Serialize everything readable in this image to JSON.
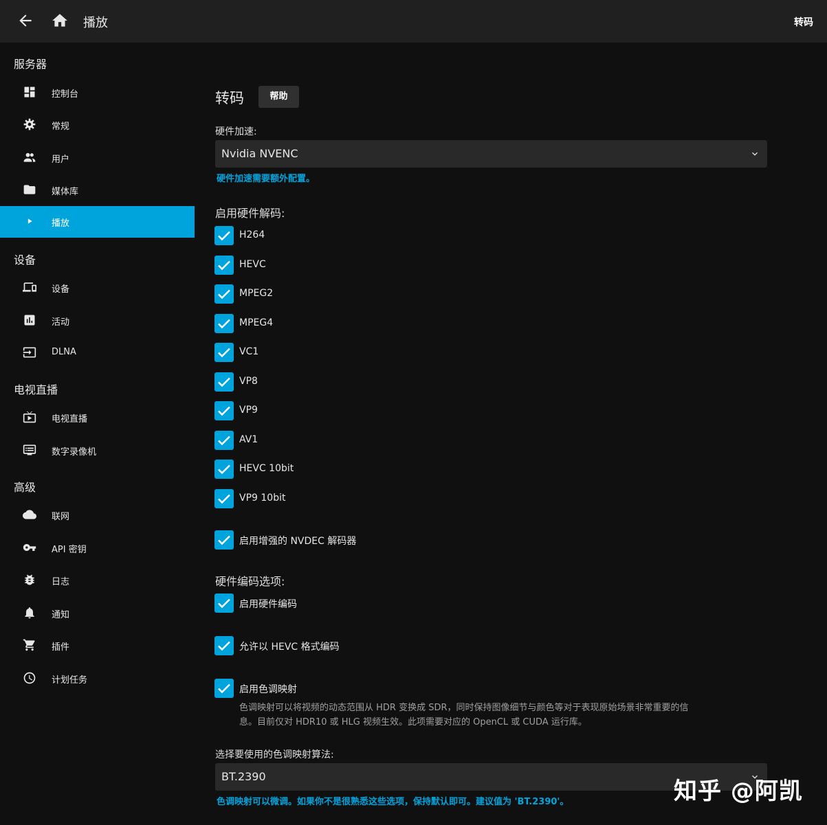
{
  "header": {
    "title": "播放",
    "right_label": "转码"
  },
  "sidebar": {
    "sections": [
      {
        "title": "服务器",
        "items": [
          {
            "label": "控制台",
            "icon": "dashboard-icon"
          },
          {
            "label": "常规",
            "icon": "gear-icon"
          },
          {
            "label": "用户",
            "icon": "users-icon"
          },
          {
            "label": "媒体库",
            "icon": "folder-icon"
          },
          {
            "label": "播放",
            "icon": "play-icon",
            "active": true
          }
        ]
      },
      {
        "title": "设备",
        "items": [
          {
            "label": "设备",
            "icon": "devices-icon"
          },
          {
            "label": "活动",
            "icon": "activity-chart-icon"
          },
          {
            "label": "DLNA",
            "icon": "input-icon"
          }
        ]
      },
      {
        "title": "电视直播",
        "items": [
          {
            "label": "电视直播",
            "icon": "live-tv-icon"
          },
          {
            "label": "数字录像机",
            "icon": "dvr-icon"
          }
        ]
      },
      {
        "title": "高级",
        "items": [
          {
            "label": "联网",
            "icon": "cloud-icon"
          },
          {
            "label": "API 密钥",
            "icon": "key-icon"
          },
          {
            "label": "日志",
            "icon": "bug-icon"
          },
          {
            "label": "通知",
            "icon": "bell-icon"
          },
          {
            "label": "插件",
            "icon": "cart-icon"
          },
          {
            "label": "计划任务",
            "icon": "clock-icon"
          }
        ]
      }
    ]
  },
  "main": {
    "title": "转码",
    "help_label": "帮助",
    "hw_accel": {
      "label": "硬件加速:",
      "value": "Nvidia NVENC",
      "hint": "硬件加速需要额外配置。"
    },
    "hw_decode": {
      "label": "启用硬件解码:",
      "codecs": [
        "H264",
        "HEVC",
        "MPEG2",
        "MPEG4",
        "VC1",
        "VP8",
        "VP9",
        "AV1",
        "HEVC 10bit",
        "VP9 10bit"
      ],
      "checked": true
    },
    "nvdec_enhanced": {
      "label": "启用增强的 NVDEC 解码器",
      "checked": true
    },
    "hw_encode": {
      "label": "硬件编码选项:",
      "enable_hw_encoding": {
        "label": "启用硬件编码",
        "checked": true
      },
      "allow_hevc": {
        "label": "允许以 HEVC 格式编码",
        "checked": true
      },
      "tone_mapping": {
        "label": "启用色调映射",
        "checked": true,
        "desc_line1": "色调映射可以将视频的动态范围从 HDR 变换成 SDR，同时保持图像细节与颜色等对于表现原始场景非常重要的信",
        "desc_line2": "息。目前仅对 HDR10 或 HLG 视频生效。此项需要对应的 OpenCL 或 CUDA 运行库。"
      }
    },
    "tonemap_algo": {
      "label": "选择要使用的色调映射算法:",
      "value": "BT.2390",
      "hint": "色调映射可以微调。如果你不是很熟悉这些选项，保持默认即可。建议值为 'BT.2390'。"
    }
  },
  "watermark": "知乎 @阿凯",
  "colors": {
    "accent": "#00a4dc",
    "header_bg": "#202020",
    "page_bg": "#101010"
  }
}
